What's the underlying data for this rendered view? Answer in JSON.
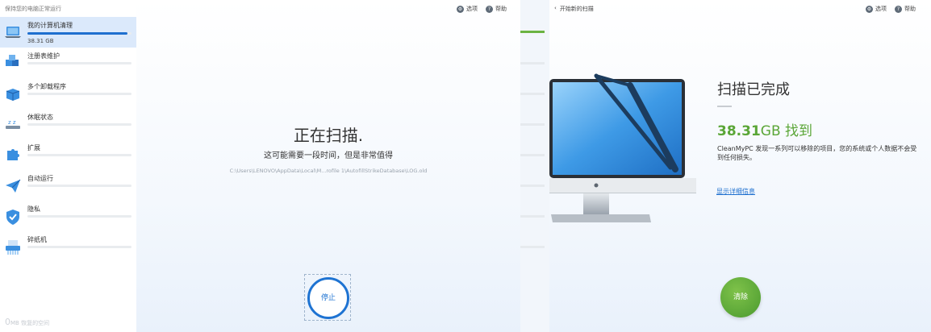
{
  "left_window": {
    "sidebar": {
      "header": "保持您的电脑正常运行",
      "items": [
        {
          "label": "我的计算机清理",
          "size": "38.31 GB",
          "active": true,
          "icon": "laptop-clean-icon"
        },
        {
          "label": "注册表维护",
          "active": false,
          "icon": "registry-cubes-icon"
        },
        {
          "label": "多个卸载程序",
          "active": false,
          "icon": "uninstall-box-icon"
        },
        {
          "label": "休眠状态",
          "active": false,
          "icon": "hibernate-zzz-icon"
        },
        {
          "label": "扩展",
          "active": false,
          "icon": "puzzle-icon"
        },
        {
          "label": "自动运行",
          "active": false,
          "icon": "paper-plane-icon"
        },
        {
          "label": "隐私",
          "active": false,
          "icon": "shield-icon"
        },
        {
          "label": "碎纸机",
          "active": false,
          "icon": "shredder-icon"
        }
      ],
      "footer_value": "0",
      "footer_label": "MB 恢复的空间"
    },
    "toolbar": {
      "options_label": "选项",
      "help_label": "帮助"
    },
    "scan": {
      "title": "正在扫描.",
      "subtitle": "这可能需要一段时间，但是非常值得",
      "path": "C:\\Users\\LENOVO\\AppData\\Local\\M...rofile 1\\AutofillStrikeDatabase\\LOG.old",
      "stop_label": "停止"
    }
  },
  "right_window": {
    "back_label": "开始新的扫描",
    "toolbar": {
      "options_label": "选项",
      "help_label": "帮助"
    },
    "result": {
      "title": "扫描已完成",
      "size_value": "38.31",
      "size_suffix": "GB 找到",
      "description": "CleanMyPC 发现一系列可以移除的项目，您的系统或个人数据不会受到任何损失。",
      "details_link": "显示详细信息",
      "clean_label": "清除"
    }
  },
  "colors": {
    "accent_blue": "#1e73d2",
    "accent_green": "#5aa637",
    "sidebar_active": "#dbe9fb"
  }
}
